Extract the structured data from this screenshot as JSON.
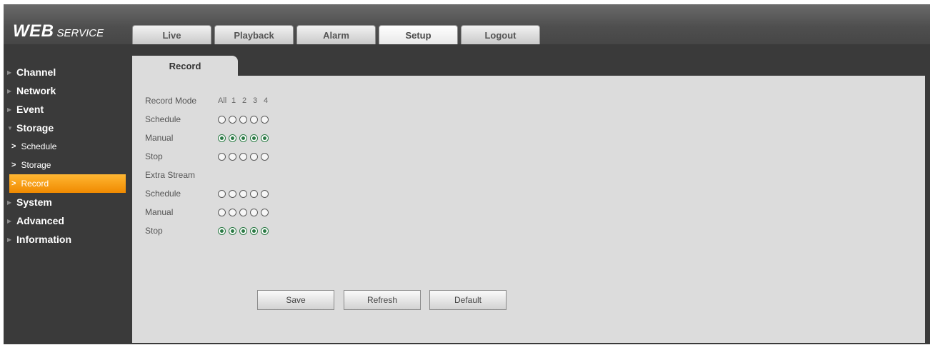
{
  "logo": {
    "web": "WEB",
    "service": "SERVICE"
  },
  "tabs": [
    "Live",
    "Playback",
    "Alarm",
    "Setup",
    "Logout"
  ],
  "sidebar": {
    "channel": "Channel",
    "network": "Network",
    "event": "Event",
    "storage": "Storage",
    "storage_sub": [
      "Schedule",
      "Storage",
      "Record"
    ],
    "system": "System",
    "advanced": "Advanced",
    "information": "Information"
  },
  "panel_tab": "Record",
  "form": {
    "record_mode_label": "Record Mode",
    "header": [
      "All",
      "1",
      "2",
      "3",
      "4"
    ],
    "main": {
      "schedule_label": "Schedule",
      "manual_label": "Manual",
      "stop_label": "Stop",
      "selected": "Manual"
    },
    "extra_stream_label": "Extra Stream",
    "extra": {
      "schedule_label": "Schedule",
      "manual_label": "Manual",
      "stop_label": "Stop",
      "selected": "Stop"
    }
  },
  "buttons": {
    "save": "Save",
    "refresh": "Refresh",
    "default": "Default"
  },
  "colors": {
    "accent": "#f39c12",
    "radio_selected": "#2b7a45"
  }
}
